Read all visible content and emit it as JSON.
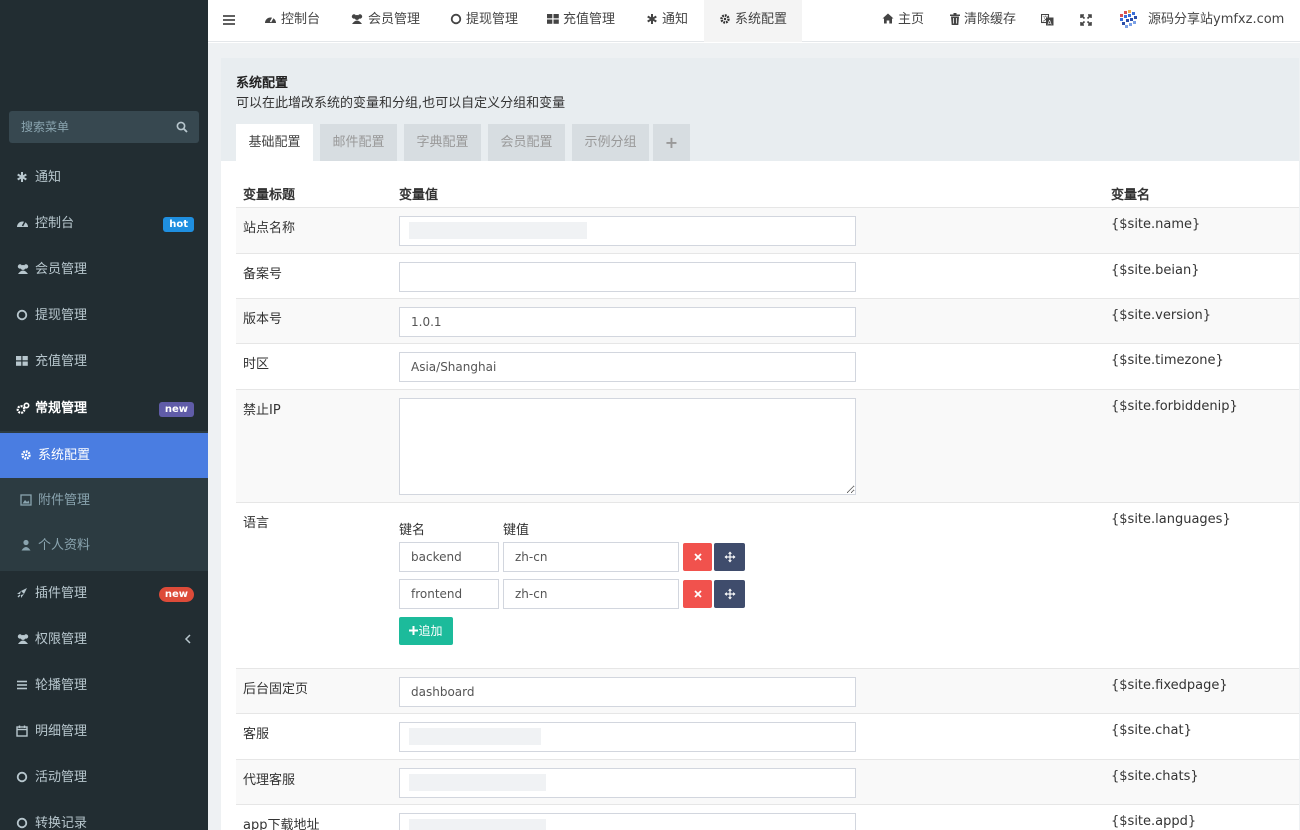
{
  "sidebar": {
    "search_placeholder": "搜索菜单",
    "items": [
      {
        "label": "通知",
        "icon": "asterisk-icon"
      },
      {
        "label": "控制台",
        "icon": "dashboard-icon",
        "badge": "hot"
      },
      {
        "label": "会员管理",
        "icon": "users-icon"
      },
      {
        "label": "提现管理",
        "icon": "circle-icon"
      },
      {
        "label": "充值管理",
        "icon": "grid-icon"
      },
      {
        "label": "常规管理",
        "icon": "cogs-icon",
        "badge": "new"
      },
      {
        "label": "插件管理",
        "icon": "rocket-icon",
        "badge": "new"
      },
      {
        "label": "权限管理",
        "icon": "users-icon"
      },
      {
        "label": "轮播管理",
        "icon": "list-icon"
      },
      {
        "label": "明细管理",
        "icon": "calendar-icon"
      },
      {
        "label": "活动管理",
        "icon": "circle-icon"
      },
      {
        "label": "转换记录",
        "icon": "circle-icon"
      }
    ],
    "subitems": [
      {
        "label": "系统配置",
        "icon": "gear-icon"
      },
      {
        "label": "附件管理",
        "icon": "image-icon"
      },
      {
        "label": "个人资料",
        "icon": "user-icon"
      }
    ]
  },
  "topbar": {
    "tabs": [
      "控制台",
      "会员管理",
      "提现管理",
      "充值管理",
      "通知",
      "系统配置"
    ],
    "home": "主页",
    "clear_cache": "清除缓存",
    "brand": "源码分享站ymfxz.com"
  },
  "panel": {
    "title": "系统配置",
    "description": "可以在此增改系统的变量和分组,也可以自定义分组和变量",
    "tabs": [
      "基础配置",
      "邮件配置",
      "字典配置",
      "会员配置",
      "示例分组",
      "+"
    ],
    "headers": {
      "title": "变量标题",
      "value": "变量值",
      "name": "变量名"
    },
    "rows": [
      {
        "label": "站点名称",
        "value": "",
        "var": "{$site.name}"
      },
      {
        "label": "备案号",
        "value": "",
        "var": "{$site.beian}"
      },
      {
        "label": "版本号",
        "value": "1.0.1",
        "var": "{$site.version}"
      },
      {
        "label": "时区",
        "value": "Asia/Shanghai",
        "var": "{$site.timezone}"
      },
      {
        "label": "禁止IP",
        "value": "",
        "var": "{$site.forbiddenip}"
      },
      {
        "label": "语言",
        "var": "{$site.languages}"
      },
      {
        "label": "后台固定页",
        "value": "dashboard",
        "var": "{$site.fixedpage}"
      },
      {
        "label": "客服",
        "value": "",
        "var": "{$site.chat}"
      },
      {
        "label": "代理客服",
        "value": "",
        "var": "{$site.chats}"
      },
      {
        "label": "app下载地址",
        "value": "",
        "var": "{$site.appd}"
      }
    ],
    "languages": {
      "key_header": "键名",
      "value_header": "键值",
      "pairs": [
        {
          "key": "backend",
          "value": "zh-cn"
        },
        {
          "key": "frontend",
          "value": "zh-cn"
        }
      ],
      "add_label": "追加"
    }
  },
  "colors": {
    "sidebar_bg": "#222d32",
    "active": "#4a7de1",
    "danger": "#f1524d",
    "success": "#1cbb9b",
    "badge_hot": "#1f8fe0",
    "badge_new": "#605ca8"
  }
}
